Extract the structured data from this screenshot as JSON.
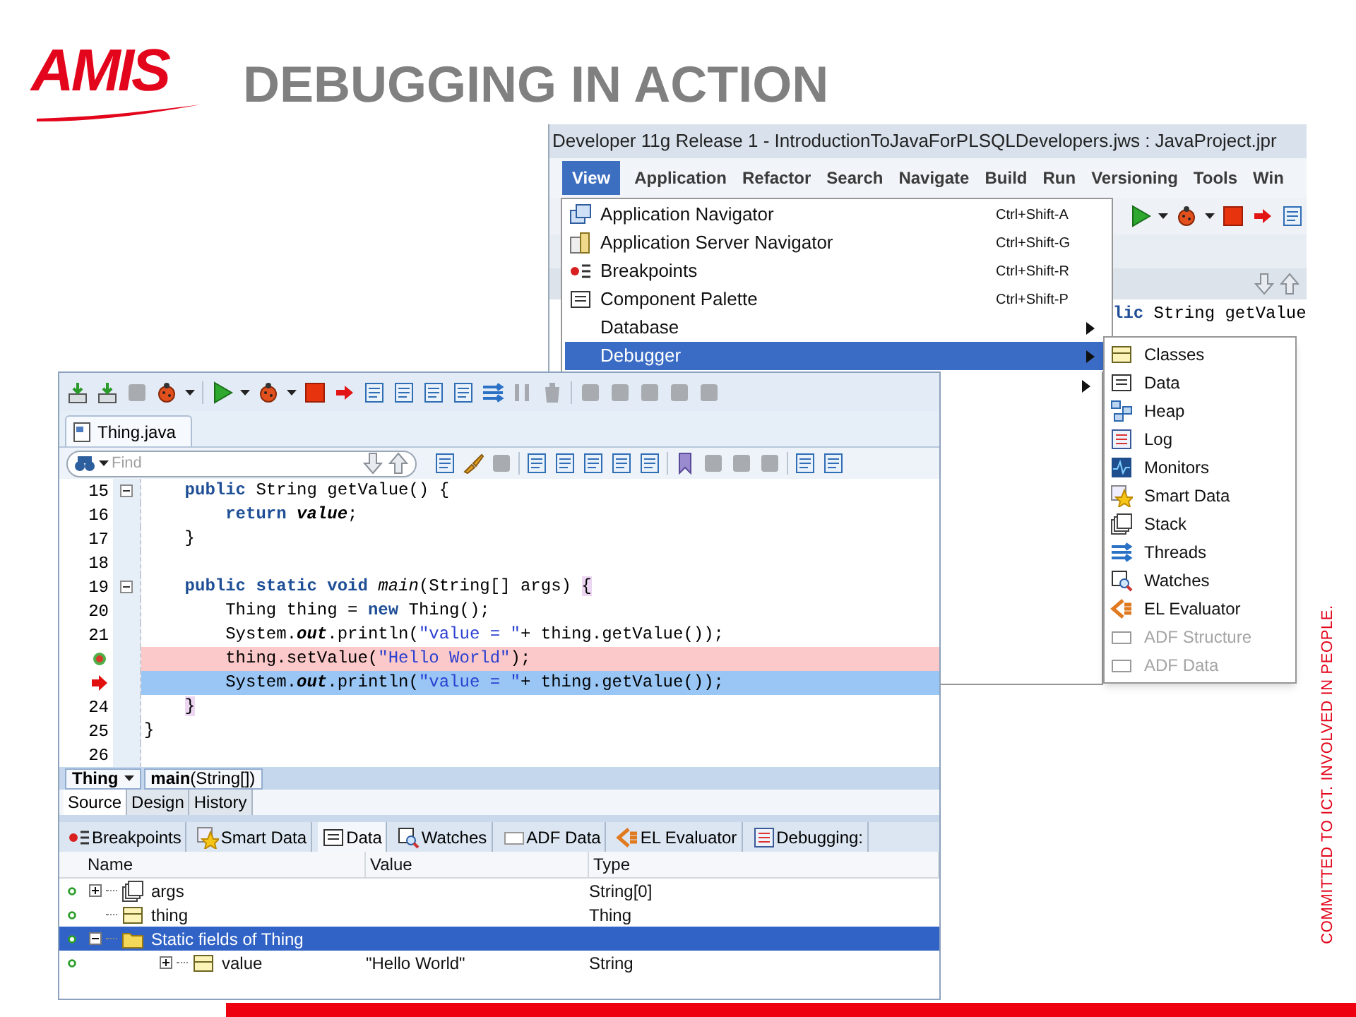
{
  "logo": "AMIS",
  "title": "DEBUGGING IN ACTION",
  "tagline": "COMMITTED TO ICT. INVOLVED IN PEOPLE.",
  "back_window": {
    "title": "Developer 11g Release 1 - IntroductionToJavaForPLSQLDevelopers.jws : JavaProject.jpr",
    "menu_bar": [
      {
        "label": "View",
        "selected": true
      },
      {
        "label": "Application",
        "selected": false
      },
      {
        "label": "Refactor",
        "selected": false
      },
      {
        "label": "Search",
        "selected": false
      },
      {
        "label": "Navigate",
        "selected": false
      },
      {
        "label": "Build",
        "selected": false
      },
      {
        "label": "Run",
        "selected": false
      },
      {
        "label": "Versioning",
        "selected": false
      },
      {
        "label": "Tools",
        "selected": false
      },
      {
        "label": "Win",
        "selected": false
      }
    ],
    "code_fragment": [
      {
        "kind": "kw",
        "text": "lic"
      },
      {
        "kind": "plain",
        "text": " String getValue"
      }
    ],
    "view_menu": [
      {
        "label": "Application Navigator",
        "shortcut": "Ctrl+Shift-A",
        "submenu": false,
        "selected": false
      },
      {
        "label": "Application Server Navigator",
        "shortcut": "Ctrl+Shift-G",
        "submenu": false,
        "selected": false
      },
      {
        "label": "Breakpoints",
        "shortcut": "Ctrl+Shift-R",
        "submenu": false,
        "selected": false
      },
      {
        "label": "Component Palette",
        "shortcut": "Ctrl+Shift-P",
        "submenu": false,
        "selected": false
      },
      {
        "label": "Database",
        "submenu": true,
        "selected": false
      },
      {
        "label": "Debugger",
        "submenu": true,
        "selected": true
      }
    ],
    "debugger_menu": [
      {
        "label": "Classes",
        "disabled": false
      },
      {
        "label": "Data",
        "disabled": false
      },
      {
        "label": "Heap",
        "disabled": false
      },
      {
        "label": "Log",
        "disabled": false
      },
      {
        "label": "Monitors",
        "disabled": false
      },
      {
        "label": "Smart Data",
        "disabled": false
      },
      {
        "label": "Stack",
        "disabled": false
      },
      {
        "label": "Threads",
        "disabled": false
      },
      {
        "label": "Watches",
        "disabled": false
      },
      {
        "label": "EL Evaluator",
        "disabled": false
      },
      {
        "label": "ADF Structure",
        "disabled": true
      },
      {
        "label": "ADF Data",
        "disabled": true
      }
    ]
  },
  "front_window": {
    "editor_tabs": [
      {
        "label": "Thing.java",
        "selected": true
      }
    ],
    "find": {
      "placeholder": "Find"
    },
    "code_lines": [
      {
        "number": "15",
        "foldable": true,
        "breakpoint": false,
        "execution_point": false,
        "tokens": [
          {
            "kind": "kw",
            "text": "    public"
          },
          {
            "kind": "plain",
            "text": " String getValue() {"
          }
        ]
      },
      {
        "number": "16",
        "foldable": false,
        "breakpoint": false,
        "execution_point": false,
        "tokens": [
          {
            "kind": "kw",
            "text": "        return "
          },
          {
            "kind": "em",
            "text": "value"
          },
          {
            "kind": "plain",
            "text": ";"
          }
        ]
      },
      {
        "number": "17",
        "foldable": false,
        "breakpoint": false,
        "execution_point": false,
        "tokens": [
          {
            "kind": "plain",
            "text": "    }"
          }
        ]
      },
      {
        "number": "18",
        "foldable": false,
        "breakpoint": false,
        "execution_point": false
      },
      {
        "number": "19",
        "foldable": true,
        "breakpoint": false,
        "execution_point": false,
        "tokens": [
          {
            "kind": "kw",
            "text": "    public static void "
          },
          {
            "kind": "it",
            "text": "main"
          },
          {
            "kind": "plain",
            "text": "(String[] args) "
          },
          {
            "kind": "brace",
            "text": "{"
          }
        ]
      },
      {
        "number": "20",
        "foldable": false,
        "breakpoint": false,
        "execution_point": false,
        "tokens": [
          {
            "kind": "plain",
            "text": "        Thing thing = "
          },
          {
            "kind": "kw",
            "text": "new"
          },
          {
            "kind": "plain",
            "text": " Thing();"
          }
        ]
      },
      {
        "number": "21",
        "foldable": false,
        "breakpoint": false,
        "execution_point": false,
        "tokens": [
          {
            "kind": "plain",
            "text": "        System."
          },
          {
            "kind": "em",
            "text": "out"
          },
          {
            "kind": "plain",
            "text": ".println("
          },
          {
            "kind": "str",
            "text": "\"value = \""
          },
          {
            "kind": "plain",
            "text": "+ thing.getValue());"
          }
        ]
      },
      {
        "foldable": false,
        "breakpoint": true,
        "execution_point": false,
        "tokens": [
          {
            "kind": "plain",
            "text": "        thing.setValue("
          },
          {
            "kind": "str",
            "text": "\"Hello World\""
          },
          {
            "kind": "plain",
            "text": ");"
          }
        ]
      },
      {
        "foldable": false,
        "breakpoint": false,
        "execution_point": true,
        "tokens": [
          {
            "kind": "plain",
            "text": "        System."
          },
          {
            "kind": "em",
            "text": "out"
          },
          {
            "kind": "plain",
            "text": ".println("
          },
          {
            "kind": "str",
            "text": "\"value = \""
          },
          {
            "kind": "plain",
            "text": "+ thing.getValue());"
          }
        ]
      },
      {
        "number": "24",
        "foldable": false,
        "breakpoint": false,
        "execution_point": false,
        "tokens": [
          {
            "kind": "brace",
            "text": "    }"
          }
        ]
      },
      {
        "number": "25",
        "foldable": false,
        "breakpoint": false,
        "execution_point": false,
        "tokens": [
          {
            "kind": "plain",
            "text": "}"
          }
        ]
      },
      {
        "number": "26",
        "foldable": false,
        "breakpoint": false,
        "execution_point": false
      }
    ],
    "breadcrumb": [
      {
        "kind": "class",
        "label": "Thing",
        "dropdown": true
      },
      {
        "kind": "method",
        "label": "**main**(String[])",
        "dropdown": false
      }
    ],
    "view_tabs": [
      {
        "label": "Source",
        "selected": true
      },
      {
        "label": "Design",
        "selected": false
      },
      {
        "label": "History",
        "selected": false
      }
    ],
    "debug_tabs": [
      {
        "label": "Breakpoints",
        "selected": false
      },
      {
        "label": "Smart Data",
        "selected": false
      },
      {
        "label": "Data",
        "selected": true
      },
      {
        "label": "Watches",
        "selected": false
      },
      {
        "label": "ADF Data",
        "selected": false
      },
      {
        "label": "EL Evaluator",
        "selected": false
      },
      {
        "label": "Debugging:",
        "selected": false
      }
    ],
    "data_table": {
      "columns": [
        "Name",
        "Value",
        "Type"
      ],
      "rows": [
        {
          "kind": "array",
          "name": "args",
          "type": "String[0]",
          "expanded": false,
          "selected": false
        },
        {
          "kind": "object",
          "name": "thing",
          "type": "Thing",
          "selected": false
        },
        {
          "kind": "folder",
          "name": "Static fields of Thing",
          "expanded": true,
          "selected": true,
          "children": [
            {
              "kind": "object",
              "name": "value",
              "value": "\"Hello World\"",
              "type": "String",
              "expanded": false,
              "selected": false
            }
          ]
        }
      ]
    }
  }
}
